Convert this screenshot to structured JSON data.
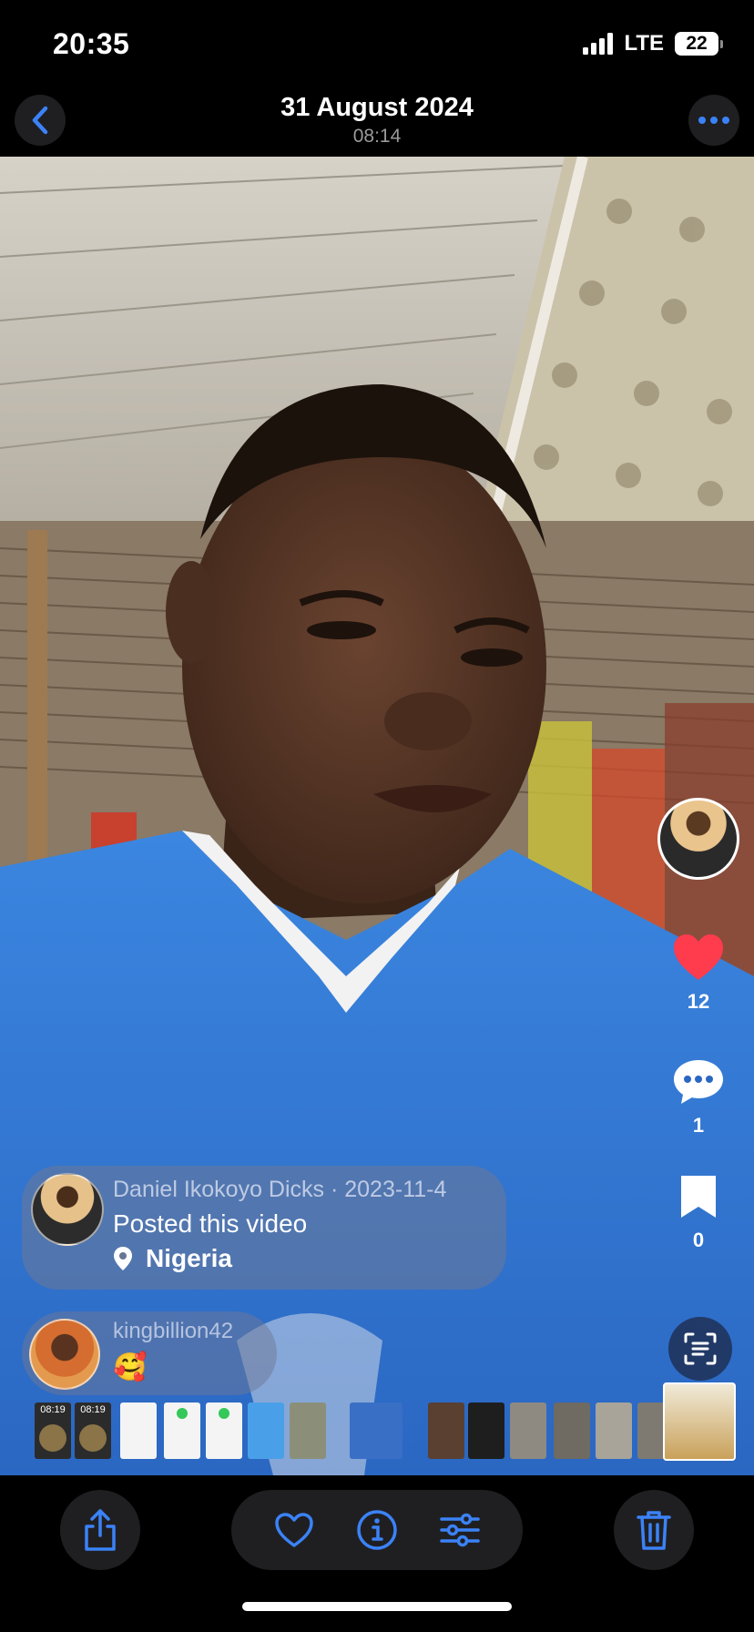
{
  "status_bar": {
    "time": "20:35",
    "network": "LTE",
    "battery": "22"
  },
  "nav": {
    "title": "31 August 2024",
    "subtitle": "08:14",
    "back_icon": "chevron-left-icon",
    "more_icon": "ellipsis-icon"
  },
  "actions": {
    "likes": "12",
    "comments": "1",
    "saves": "0"
  },
  "post": {
    "author_date": "Daniel Ikokoyo Dicks · 2023-11-4",
    "action": "Posted this video",
    "location": "Nigeria"
  },
  "comment": {
    "user": "kingbillion42",
    "text": "🥰"
  },
  "thumbnails": {
    "times": [
      "08:19",
      "08:19"
    ]
  },
  "colors": {
    "accent": "#3b82f6",
    "heart": "#ff3b4e",
    "toolbar_bg": "#1f1f22"
  }
}
